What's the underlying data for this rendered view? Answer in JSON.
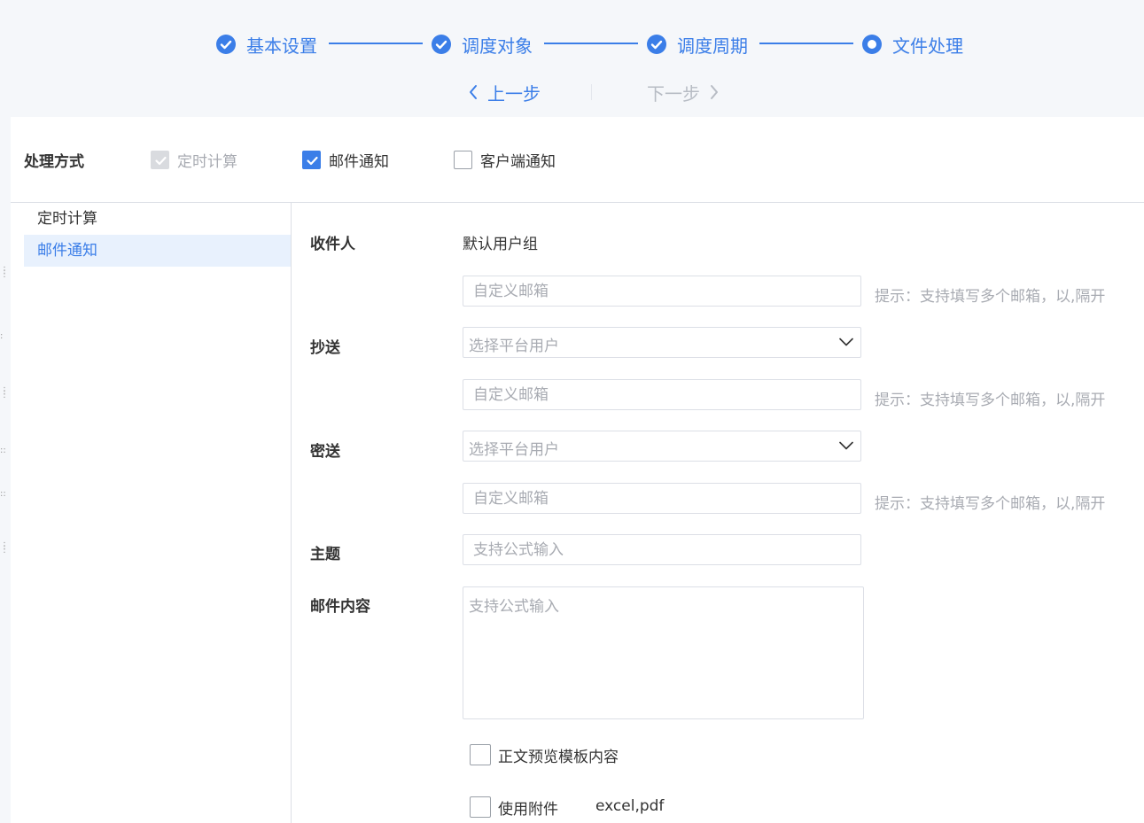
{
  "colors": {
    "primary": "#3b7ee8",
    "muted": "#a8abb2",
    "border": "#dcdfe6",
    "page_bg": "#f5f7fa"
  },
  "steps": [
    {
      "label": "基本设置",
      "status": "done",
      "icon": "check-circle-icon"
    },
    {
      "label": "调度对象",
      "status": "done",
      "icon": "check-circle-icon"
    },
    {
      "label": "调度周期",
      "status": "done",
      "icon": "check-circle-icon"
    },
    {
      "label": "文件处理",
      "status": "active",
      "icon": "radio-dot-icon"
    }
  ],
  "nav": {
    "prev_label": "上一步",
    "next_label": "下一步",
    "next_disabled": true
  },
  "processing": {
    "label": "处理方式",
    "options": [
      {
        "label": "定时计算",
        "checked": true,
        "disabled": true
      },
      {
        "label": "邮件通知",
        "checked": true,
        "disabled": false
      },
      {
        "label": "客户端通知",
        "checked": false,
        "disabled": false
      }
    ]
  },
  "sidebar": {
    "items": [
      {
        "label": "定时计算",
        "active": false
      },
      {
        "label": "邮件通知",
        "active": true
      }
    ]
  },
  "form": {
    "recipient": {
      "label": "收件人",
      "value": "默认用户组",
      "email_placeholder": "自定义邮箱",
      "hint": "提示：支持填写多个邮箱，以,隔开"
    },
    "cc": {
      "label": "抄送",
      "select_placeholder": "选择平台用户",
      "email_placeholder": "自定义邮箱",
      "hint": "提示：支持填写多个邮箱，以,隔开"
    },
    "bcc": {
      "label": "密送",
      "select_placeholder": "选择平台用户",
      "email_placeholder": "自定义邮箱",
      "hint": "提示：支持填写多个邮箱，以,隔开"
    },
    "subject": {
      "label": "主题",
      "placeholder": "支持公式输入"
    },
    "content": {
      "label": "邮件内容",
      "placeholder": "支持公式输入"
    },
    "preview_template": {
      "label": "正文预览模板内容",
      "checked": false
    },
    "attachment": {
      "label": "使用附件",
      "checked": false,
      "types": "excel,pdf"
    }
  }
}
